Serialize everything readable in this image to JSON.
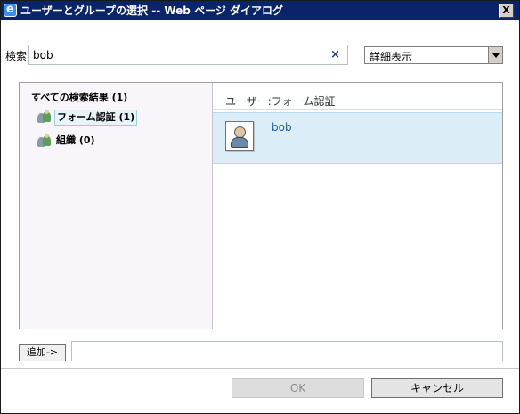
{
  "window": {
    "title": "ユーザーとグループの選択 -- Web ページ ダイアログ",
    "close_label": "X"
  },
  "search": {
    "label": "検索",
    "value": "bob",
    "clear_label": "×"
  },
  "view_select": {
    "selected": "詳細表示"
  },
  "tree": {
    "all_results": "すべての検索結果 (1)",
    "items": [
      {
        "label": "フォーム認証 (1)"
      },
      {
        "label": "組織 (0)"
      }
    ]
  },
  "results": {
    "section_header": "ユーザー:フォーム認証",
    "rows": [
      {
        "name": "bob"
      }
    ]
  },
  "footer": {
    "add_label": "追加->",
    "ok_label": "OK",
    "cancel_label": "キャンセル"
  }
}
